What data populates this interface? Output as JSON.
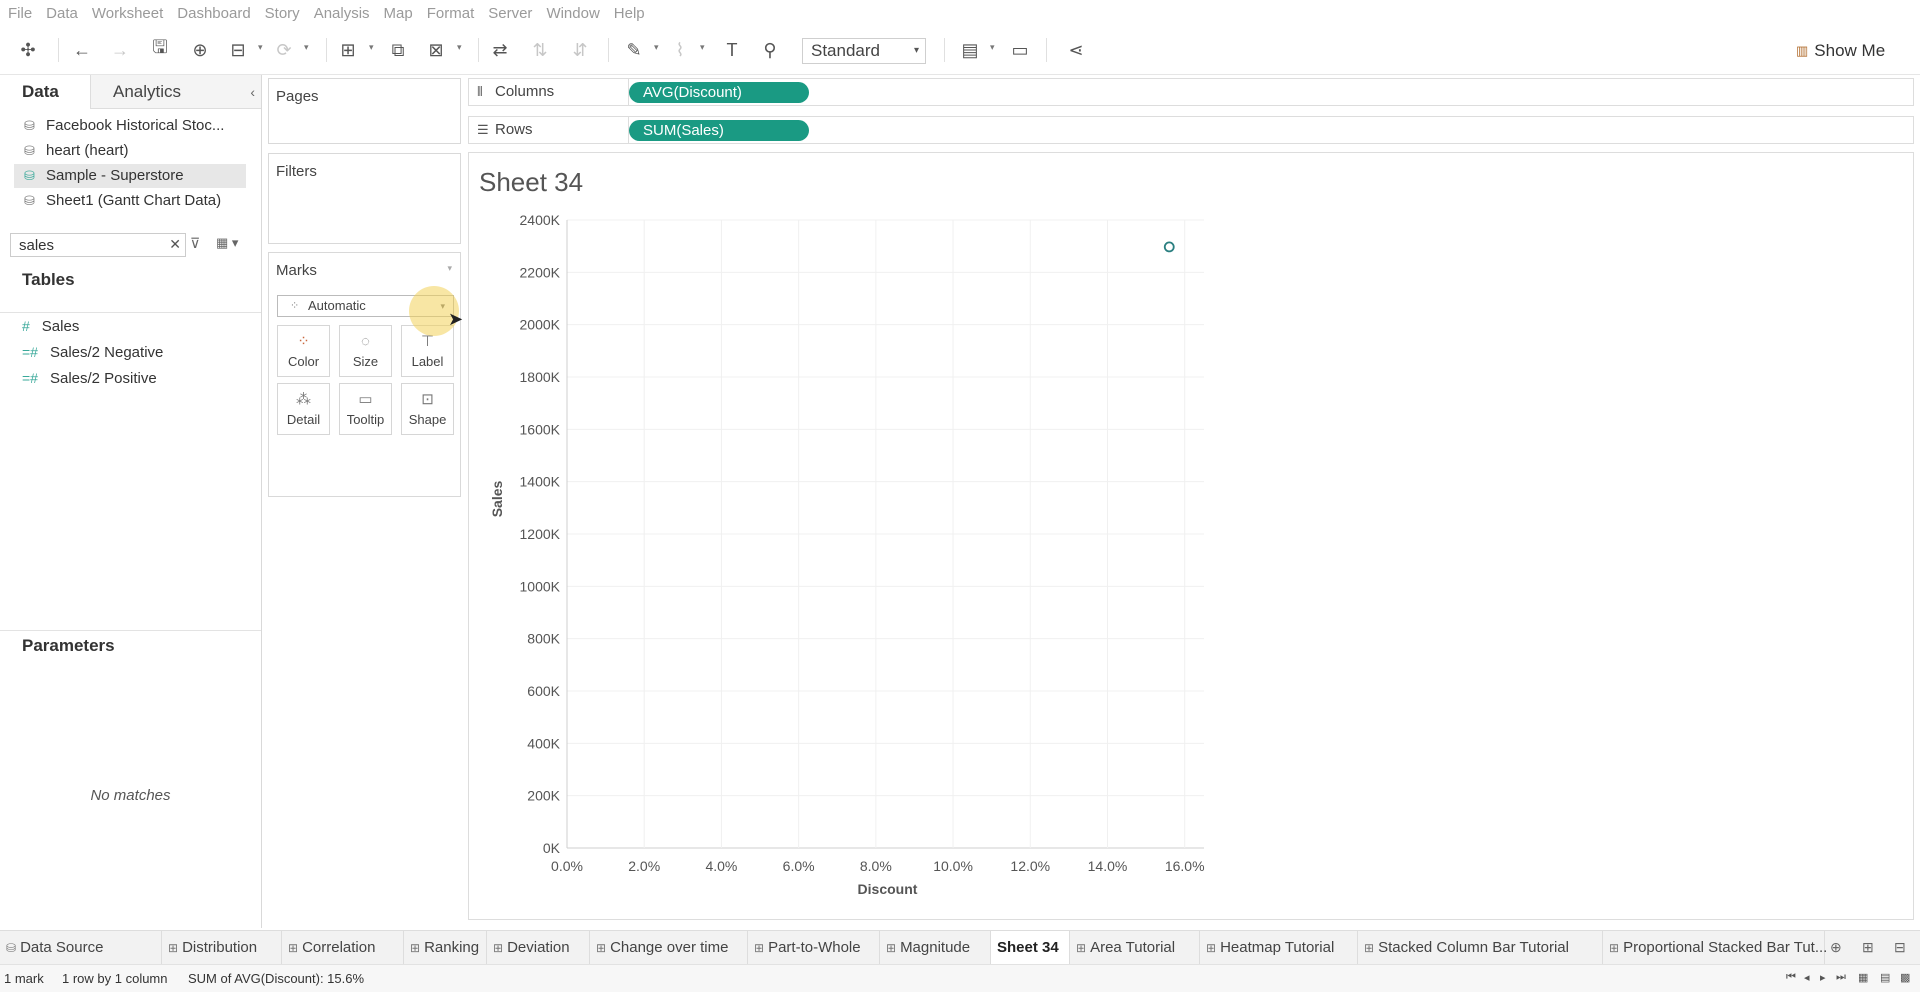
{
  "menu": [
    "File",
    "Data",
    "Worksheet",
    "Dashboard",
    "Story",
    "Analysis",
    "Map",
    "Format",
    "Server",
    "Window",
    "Help"
  ],
  "toolbar": {
    "fit_value": "Standard",
    "show_me_label": "Show Me"
  },
  "datapane": {
    "tab_data": "Data",
    "tab_analytics": "Analytics",
    "sources": [
      "Facebook Historical Stoc...",
      "heart (heart)",
      "Sample - Superstore",
      "Sheet1 (Gantt Chart Data)"
    ],
    "search_value": "sales",
    "tables_heading": "Tables",
    "fields": [
      "Sales",
      "Sales/2 Negative",
      "Sales/2 Positive"
    ],
    "parameters_heading": "Parameters",
    "no_matches": "No matches"
  },
  "cards": {
    "pages": "Pages",
    "filters": "Filters",
    "marks": "Marks",
    "mark_type": "Automatic",
    "mark_buttons": [
      "Color",
      "Size",
      "Label",
      "Detail",
      "Tooltip",
      "Shape"
    ]
  },
  "shelves": {
    "columns_label": "Columns",
    "columns_pill": "AVG(Discount)",
    "rows_label": "Rows",
    "rows_pill": "SUM(Sales)"
  },
  "sheet_title": "Sheet 34",
  "chart_data": {
    "type": "scatter",
    "xlabel": "Discount",
    "ylabel": "Sales",
    "x_ticks": [
      "0.0%",
      "2.0%",
      "4.0%",
      "6.0%",
      "8.0%",
      "10.0%",
      "12.0%",
      "14.0%",
      "16.0%"
    ],
    "y_ticks": [
      "0K",
      "200K",
      "400K",
      "600K",
      "800K",
      "1000K",
      "1200K",
      "1400K",
      "1600K",
      "1800K",
      "2000K",
      "2200K",
      "2400K"
    ],
    "xlim": [
      0,
      0.165
    ],
    "ylim": [
      0,
      2400000
    ],
    "points": [
      {
        "x": 0.156,
        "y": 2297201
      }
    ],
    "mark_color": "#2a7f80",
    "grid": true
  },
  "sheet_tabs": [
    "Data Source",
    "Distribution",
    "Correlation",
    "Ranking",
    "Deviation",
    "Change over time",
    "Part-to-Whole",
    "Magnitude",
    "Sheet 34",
    "Area Tutorial",
    "Heatmap Tutorial",
    "Stacked Column Bar Tutorial",
    "Proportional Stacked Bar Tut..."
  ],
  "active_tab": "Sheet 34",
  "status": {
    "marks": "1 mark",
    "dims": "1 row by 1 column",
    "sum": "SUM of AVG(Discount): 15.6%"
  }
}
